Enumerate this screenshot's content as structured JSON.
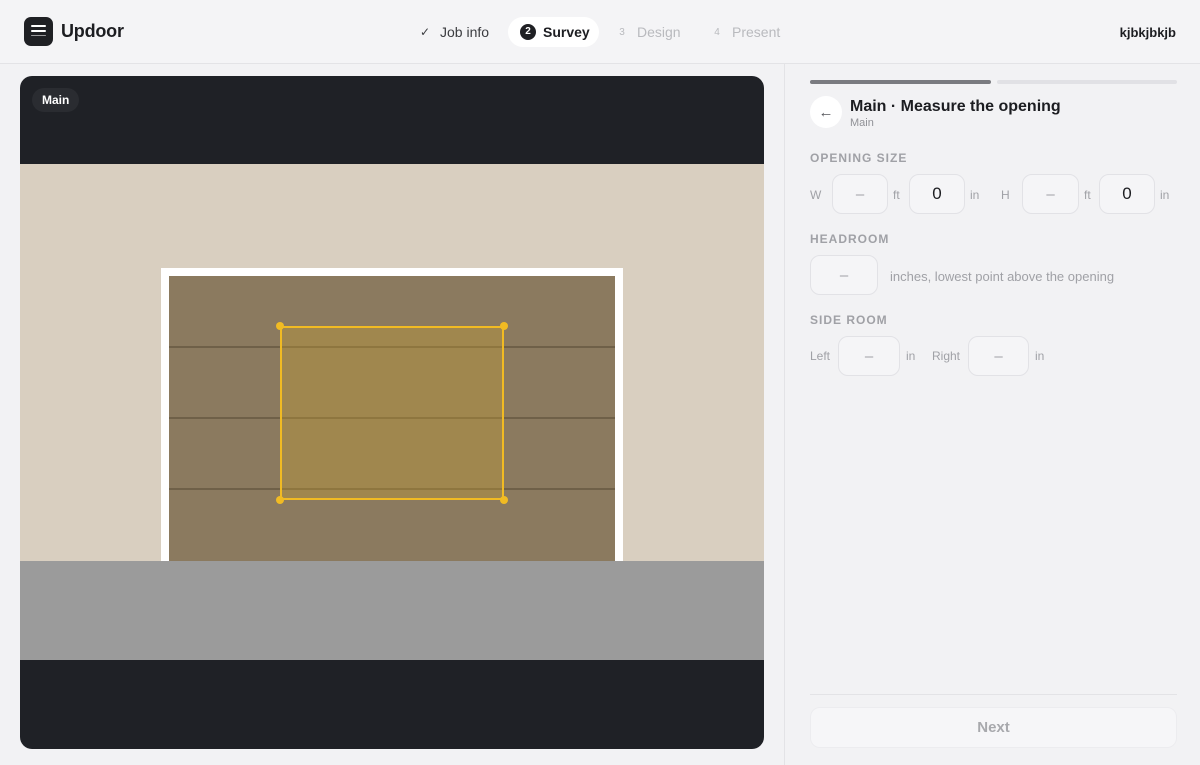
{
  "app": {
    "name": "Updoor",
    "user": "kjbkjbkjb"
  },
  "stepper": [
    {
      "mark": "✓",
      "label": "Job info",
      "state": "done"
    },
    {
      "mark": "2",
      "label": "Survey",
      "state": "active"
    },
    {
      "mark": "3",
      "label": "Design",
      "state": "upcoming"
    },
    {
      "mark": "4",
      "label": "Present",
      "state": "upcoming"
    }
  ],
  "viewer": {
    "tag": "Main"
  },
  "panel": {
    "progress": {
      "completed": 1,
      "total": 2,
      "colors": {
        "done": "#7a7b80",
        "todo": "#e1e1e5"
      }
    },
    "back_icon": "←",
    "title": "Main · Measure the opening",
    "subtitle": "Main",
    "opening_size": {
      "label": "OPENING SIZE",
      "w_label": "W",
      "w_ft": "–",
      "ft_unit": "ft",
      "w_in": "0",
      "in_unit": "in",
      "h_label": "H",
      "h_ft": "–",
      "h_in": "0"
    },
    "headroom": {
      "label": "HEADROOM",
      "value": "–",
      "hint": "inches, lowest point above the opening"
    },
    "side_room": {
      "label": "SIDE ROOM",
      "left_label": "Left",
      "left_value": "–",
      "right_label": "Right",
      "right_value": "–",
      "unit": "in"
    },
    "next_label": "Next"
  },
  "colors": {
    "accent": "#f1bb23",
    "dark": "#1f2126"
  }
}
